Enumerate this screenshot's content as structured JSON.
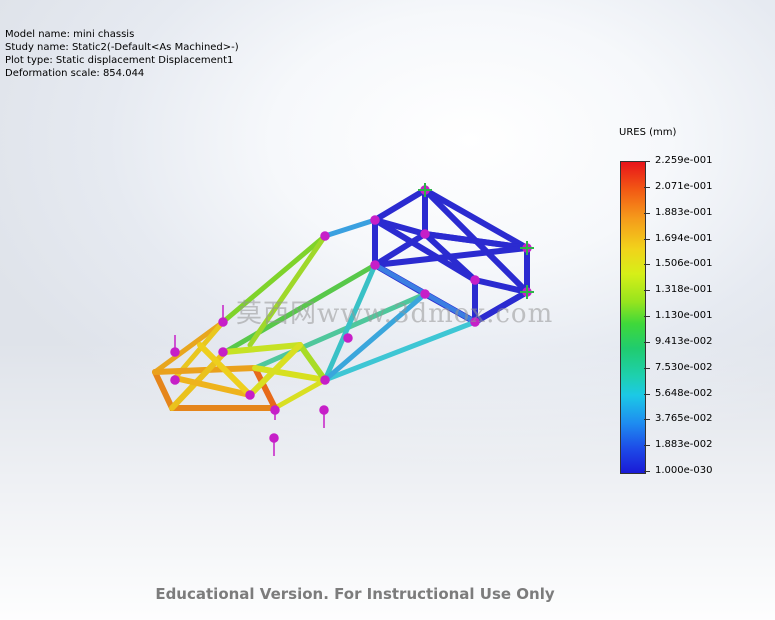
{
  "study_info": {
    "model_name": "Model name: mini chassis",
    "study_name": "Study name: Static2(-Default<As Machined>-)",
    "plot_type": "Plot type: Static displacement Displacement1",
    "deformation_scale": "Deformation scale: 854.044"
  },
  "legend": {
    "title": "URES (mm)",
    "ticks": [
      "2.259e-001",
      "2.071e-001",
      "1.883e-001",
      "1.694e-001",
      "1.506e-001",
      "1.318e-001",
      "1.130e-001",
      "9.413e-002",
      "7.530e-002",
      "5.648e-002",
      "3.765e-002",
      "1.883e-002",
      "1.000e-030"
    ]
  },
  "watermark": "莫西网www.3dmox.com",
  "footer": "Educational Version. For Instructional Use Only",
  "colors": {
    "max": "#e8141a",
    "mid": "#3fd83a",
    "min": "#1a1ad6",
    "fixture": "#c61fc8",
    "load_arrow": "#2db34a"
  }
}
